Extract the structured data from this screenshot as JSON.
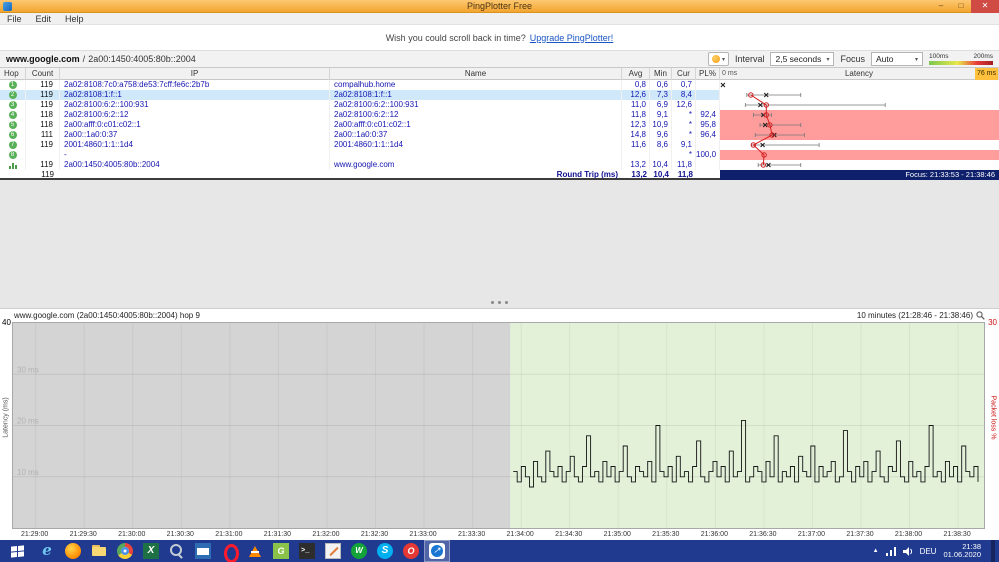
{
  "window": {
    "title": "PingPlotter Free",
    "controls": {
      "minimize": "–",
      "maximize": "□",
      "close": "✕"
    }
  },
  "menu": [
    "File",
    "Edit",
    "Help"
  ],
  "upgrade": {
    "text": "Wish you could scroll back in time?",
    "link": "Upgrade PingPlotter!"
  },
  "targetbar": {
    "target": "www.google.com",
    "sep": "/",
    "address": "2a00:1450:4005:80b::2004",
    "interval_label": "Interval",
    "interval_value": "2,5 seconds",
    "focus_label": "Focus",
    "focus_value": "Auto",
    "legend": {
      "low": "100ms",
      "high": "200ms"
    },
    "chevron": "▾"
  },
  "table": {
    "headers": {
      "hop": "Hop",
      "count": "Count",
      "ip": "IP",
      "name": "Name",
      "avg": "Avg",
      "min": "Min",
      "cur": "Cur",
      "pl": "PL%",
      "latency": "Latency",
      "scale_min": "0 ms",
      "scale_max": "76 ms"
    },
    "rows": [
      {
        "hop": "1",
        "badge": "number",
        "count": "119",
        "ip": "2a02:8108:7c0:a758:de53:7cff:fe6c:2b7b",
        "name": "compalhub.home",
        "avg": "0,8",
        "min": "0,6",
        "cur": "0,7",
        "pl": "",
        "selected": false,
        "loss": false,
        "g": {
          "avg": 0.8
        }
      },
      {
        "hop": "2",
        "badge": "number",
        "count": "119",
        "ip": "2a02:8108:1:f::1",
        "name": "2a02:8108:1:f::1",
        "avg": "12,6",
        "min": "7,3",
        "cur": "8,4",
        "pl": "",
        "selected": true,
        "loss": false,
        "g": {
          "min": 7.3,
          "max": 22,
          "avg": 12.6,
          "cur": 8.4
        }
      },
      {
        "hop": "3",
        "badge": "number",
        "count": "119",
        "ip": "2a02:8100:6:2::100:931",
        "name": "2a02:8100:6:2::100:931",
        "avg": "11,0",
        "min": "6,9",
        "cur": "12,6",
        "pl": "",
        "selected": false,
        "loss": false,
        "g": {
          "min": 6.9,
          "max": 45,
          "avg": 11.0,
          "cur": 12.6
        }
      },
      {
        "hop": "4",
        "badge": "number",
        "count": "118",
        "ip": "2a02:8100:6:2::12",
        "name": "2a02:8100:6:2::12",
        "avg": "11,8",
        "min": "9,1",
        "cur": "*",
        "pl": "92,4",
        "selected": false,
        "loss": true,
        "g": {
          "min": 9.1,
          "max": 14,
          "avg": 11.8,
          "cur": 12.6
        }
      },
      {
        "hop": "5",
        "badge": "number",
        "count": "118",
        "ip": "2a00:afff:0:c01:c02::1",
        "name": "2a00:afff:0:c01:c02::1",
        "avg": "12,3",
        "min": "10,9",
        "cur": "*",
        "pl": "95,8",
        "selected": false,
        "loss": true,
        "g": {
          "min": 10.9,
          "max": 22,
          "avg": 12.3,
          "cur": 13.6
        }
      },
      {
        "hop": "6",
        "badge": "number",
        "count": "111",
        "ip": "2a00::1a0:0:37",
        "name": "2a00::1a0:0:37",
        "avg": "14,8",
        "min": "9,6",
        "cur": "*",
        "pl": "96,4",
        "selected": false,
        "loss": true,
        "g": {
          "min": 9.6,
          "max": 23,
          "avg": 14.8,
          "cur": 14.2
        }
      },
      {
        "hop": "7",
        "badge": "number",
        "count": "119",
        "ip": "2001:4860:1:1::1d4",
        "name": "2001:4860:1:1::1d4",
        "avg": "11,6",
        "min": "8,6",
        "cur": "9,1",
        "pl": "",
        "selected": false,
        "loss": false,
        "g": {
          "min": 8.6,
          "max": 27,
          "avg": 11.6,
          "cur": 9.1
        }
      },
      {
        "hop": "8",
        "badge": "number",
        "count": "",
        "ip": "-",
        "name": "",
        "avg": "",
        "min": "",
        "cur": "*",
        "pl": "100,0",
        "selected": false,
        "loss": true,
        "g": {
          "cur": 12.0
        }
      },
      {
        "hop": "9",
        "badge": "chart",
        "count": "119",
        "ip": "2a00:1450:4005:80b::2004",
        "name": "www.google.com",
        "avg": "13,2",
        "min": "10,4",
        "cur": "11,8",
        "pl": "",
        "selected": false,
        "loss": false,
        "g": {
          "min": 10.4,
          "max": 22,
          "avg": 13.2,
          "cur": 11.8
        }
      }
    ],
    "latency_scale_ms": 76,
    "roundtrip": {
      "count": "119",
      "label": "Round Trip (ms)",
      "avg": "13,2",
      "min": "10,4",
      "cur": "11,8"
    },
    "focus_status": "Focus: 21:33:53 - 21:38:46"
  },
  "timeline": {
    "title": "www.google.com (2a00:1450:4005:80b::2004) hop 9",
    "range_label": "10 minutes (21:28:46 - 21:38:46)",
    "ylabel": "Latency (ms)",
    "ylabel_right": "Packet loss %",
    "y_max_label": "40",
    "pl_max_label": "30",
    "y_max": 40,
    "grid_values": [
      10,
      20,
      30
    ],
    "focus_start_frac": 0.512,
    "x_ticks": [
      "21:29:00",
      "21:29:30",
      "21:30:00",
      "21:30:30",
      "21:31:00",
      "21:31:30",
      "21:32:00",
      "21:32:30",
      "21:33:00",
      "21:33:30",
      "21:34:00",
      "21:34:30",
      "21:35:00",
      "21:35:30",
      "21:36:00",
      "21:36:30",
      "21:37:00",
      "21:37:30",
      "21:38:00",
      "21:38:30"
    ],
    "samples": [
      11,
      9,
      12,
      10,
      8,
      13,
      10,
      9,
      15,
      11,
      10,
      12,
      9,
      11,
      14,
      10,
      9,
      12,
      18,
      10,
      11,
      9,
      13,
      10,
      12,
      9,
      11,
      16,
      10,
      9,
      12,
      11,
      10,
      13,
      9,
      20,
      11,
      10,
      12,
      9,
      14,
      10,
      11,
      9,
      12,
      17,
      10,
      9,
      11,
      13,
      10,
      12,
      9,
      15,
      10,
      11,
      21,
      9,
      10,
      12,
      11,
      9,
      13,
      10,
      18,
      9,
      11,
      10,
      12,
      9,
      14,
      11,
      10,
      16,
      9,
      12,
      10,
      11,
      13,
      9,
      10,
      19,
      11,
      9,
      12,
      10,
      13,
      9,
      11,
      15,
      10,
      9,
      12,
      11,
      17,
      10,
      9,
      13,
      10,
      11,
      9,
      12,
      20,
      10,
      11,
      9,
      13,
      10,
      12,
      9,
      16,
      11,
      10,
      12,
      9
    ]
  },
  "taskbar": {
    "icons": [
      "internet-explorer",
      "firefox",
      "file-explorer",
      "chrome",
      "excel",
      "search",
      "mail",
      "opera",
      "vlc",
      "greenshot",
      "cmd",
      "paint",
      "webex",
      "skype",
      "opera-red",
      "pingplotter"
    ],
    "active_icon": "pingplotter",
    "tray": {
      "language": "DEU",
      "time": "21:38",
      "date": "01.06.2020"
    }
  }
}
